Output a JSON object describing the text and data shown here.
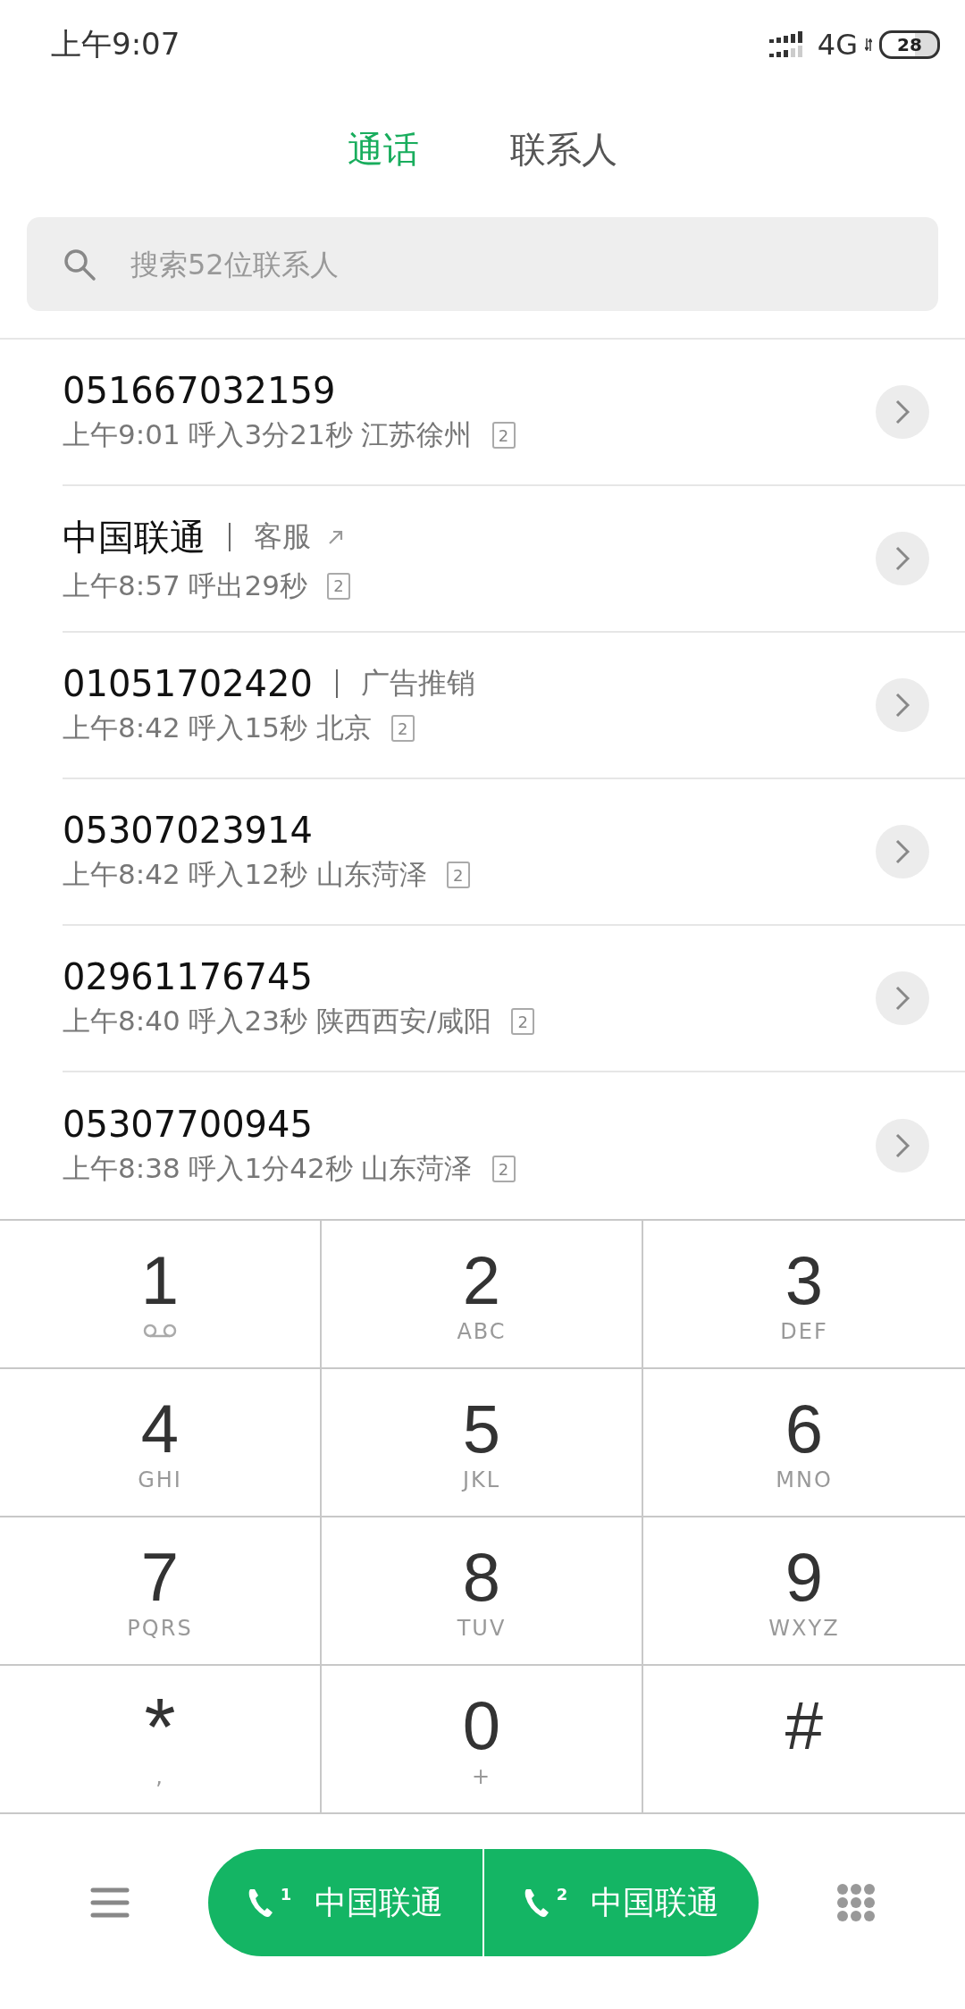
{
  "status_bar": {
    "time": "上午9:07",
    "network": "4G",
    "battery": "28"
  },
  "tabs": [
    {
      "label": "通话",
      "selected": true
    },
    {
      "label": "联系人",
      "selected": false
    }
  ],
  "search": {
    "placeholder": "搜索52位联系人"
  },
  "calls": [
    {
      "title": "051667032159",
      "detail": "上午9:01 呼入3分21秒 江苏徐州",
      "sim": "2"
    },
    {
      "title": "中国联通",
      "tag": "客服",
      "tag_link": true,
      "detail": "上午8:57 呼出29秒",
      "sim": "2"
    },
    {
      "title": "01051702420",
      "tag": "广告推销",
      "tag_link": false,
      "detail": "上午8:42 呼入15秒 北京",
      "sim": "2"
    },
    {
      "title": "05307023914",
      "detail": "上午8:42 呼入12秒 山东菏泽",
      "sim": "2"
    },
    {
      "title": "02961176745",
      "detail": "上午8:40 呼入23秒 陕西西安/咸阳",
      "sim": "2"
    },
    {
      "title": "05307700945",
      "detail": "上午8:38 呼入1分42秒 山东菏泽",
      "sim": "2"
    }
  ],
  "keypad": [
    {
      "digit": "1",
      "kind": "voicemail"
    },
    {
      "digit": "2",
      "kind": "text",
      "sub": "ABC"
    },
    {
      "digit": "3",
      "kind": "text",
      "sub": "DEF"
    },
    {
      "digit": "4",
      "kind": "text",
      "sub": "GHI"
    },
    {
      "digit": "5",
      "kind": "text",
      "sub": "JKL"
    },
    {
      "digit": "6",
      "kind": "text",
      "sub": "MNO"
    },
    {
      "digit": "7",
      "kind": "text",
      "sub": "PQRS"
    },
    {
      "digit": "8",
      "kind": "text",
      "sub": "TUV"
    },
    {
      "digit": "9",
      "kind": "text",
      "sub": "WXYZ"
    },
    {
      "digit": "*",
      "kind": "text",
      "sub": ","
    },
    {
      "digit": "0",
      "kind": "text",
      "sub": "+"
    },
    {
      "digit": "#",
      "kind": "plain"
    }
  ],
  "call_buttons": [
    {
      "sim": "1",
      "label": "中国联通"
    },
    {
      "sim": "2",
      "label": "中国联通"
    }
  ]
}
